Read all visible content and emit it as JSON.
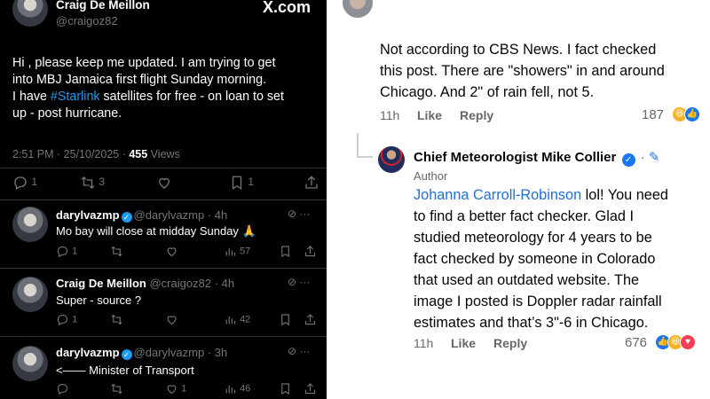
{
  "tweet": {
    "author_name": "Craig De Meillon",
    "author_handle": "@craigoz82",
    "brand": "X.com",
    "body_line1": "Hi , please keep me updated. I am trying to get",
    "body_line2": "into MBJ Jamaica first flight Sunday morning.",
    "body_line3_pre": "I have ",
    "body_hashtag": "#Starlink",
    "body_line3_post": " satellites for free - on loan to set",
    "body_line4": "up - post hurricane.",
    "timestamp": "2:51 PM · 25/10/2025 · ",
    "views_count": "455",
    "views_label": " Views",
    "replies": "1",
    "reposts": "3",
    "bookmarks": "1"
  },
  "replies": [
    {
      "name": "darylvazmp",
      "handle": "@darylvazmp · 4h",
      "text": "Mo bay will close at midday Sunday 🙏",
      "replies": "1",
      "views": "57"
    },
    {
      "name": "Craig De Meillon",
      "handle": "@craigoz82 · 4h",
      "text": "Super - source ?",
      "replies": "1",
      "views": "42"
    },
    {
      "name": "darylvazmp",
      "handle": "@darylvazmp · 3h",
      "text": "<—— Minister of Transport",
      "likes": "1",
      "views": "46"
    }
  ],
  "fb_comment": {
    "line1": "Not according to CBS News. I fact checked",
    "line2": "this post. There are \"showers\" in and around",
    "line3": "Chicago. And 2\" of rain fell, not 5.",
    "time": "11h",
    "like_label": "Like",
    "reply_label": "Reply",
    "reaction_count": "187"
  },
  "fb_reply": {
    "name": "Chief Meteorologist Mike Collier",
    "badge": "Author",
    "mention": "Johanna Carroll-Robinson",
    "line1_rest": " lol! You need",
    "line2": "to find a better fact checker. Glad I",
    "line3": "studied meteorology for 4 years to be",
    "line4": "fact checked by someone in Colorado",
    "line5": "that used an outdated website. The",
    "line6": "image I posted is Doppler radar rainfall",
    "line7": "estimates and that’s 3\"-6 in Chicago.",
    "time": "11h",
    "like_label": "Like",
    "reply_label": "Reply",
    "reaction_count": "676"
  },
  "colors": {
    "x_background": "#000000",
    "x_link": "#1d9bf0",
    "x_muted": "#71767b",
    "fb_link": "#216fdb",
    "fb_muted": "#65676b"
  }
}
